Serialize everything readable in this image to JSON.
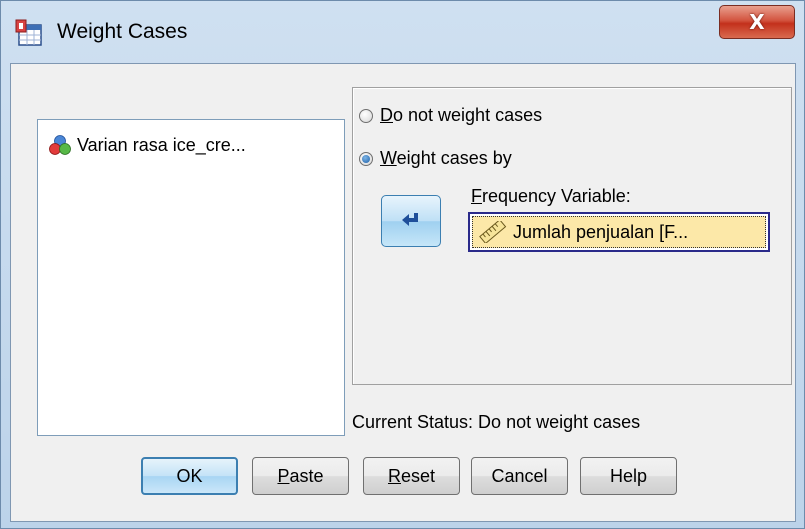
{
  "window": {
    "title": "Weight Cases",
    "close_label": "X"
  },
  "variable_list": {
    "items": [
      {
        "label": "Varian rasa ice_cre...",
        "icon": "nominal-variable-icon"
      }
    ]
  },
  "weight_options": {
    "do_not_weight": {
      "label_rest": "o not weight cases",
      "mnemonic": "D",
      "checked": false
    },
    "weight_by": {
      "label_rest": "eight cases by",
      "mnemonic": "W",
      "checked": true
    }
  },
  "move_button": {
    "icon": "arrow-left-icon"
  },
  "frequency": {
    "label_rest": "requency Variable:",
    "mnemonic": "F",
    "value": "Jumlah penjualan  [F...",
    "icon": "scale-variable-icon"
  },
  "status": {
    "text": "Current Status: Do not weight cases"
  },
  "buttons": {
    "ok": "OK",
    "paste_mnemonic": "P",
    "paste_rest": "aste",
    "reset_mnemonic": "R",
    "reset_rest": "eset",
    "cancel": "Cancel",
    "help": "Help"
  },
  "colors": {
    "accent": "#3c7fb1",
    "selection_bg": "#fce8a8",
    "close": "#c3301c"
  }
}
